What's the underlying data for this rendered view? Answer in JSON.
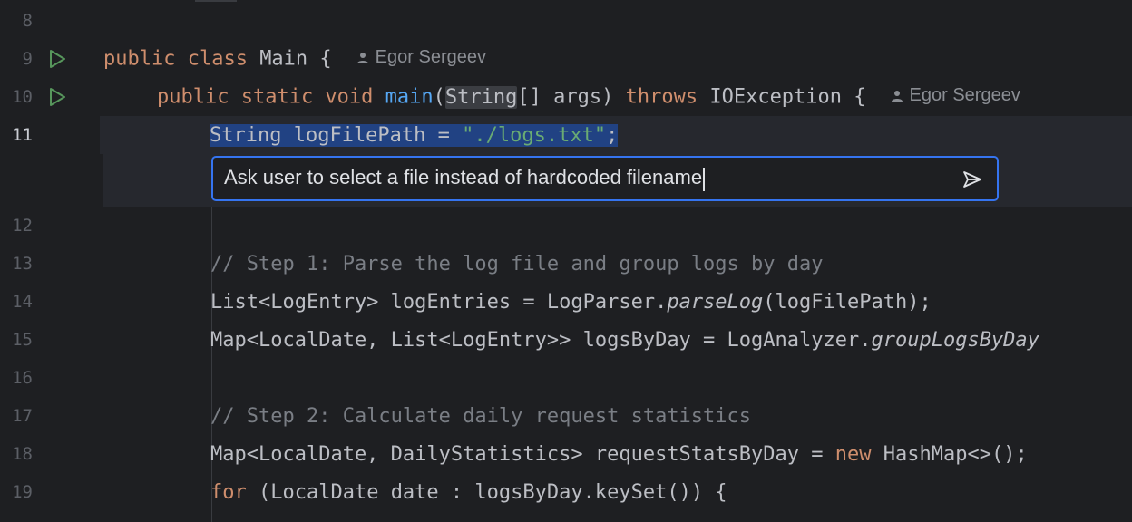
{
  "editor": {
    "lines": [
      {
        "num": "8",
        "code": ""
      },
      {
        "num": "9",
        "code_parts": {
          "kw1": "public class ",
          "name": "Main {"
        },
        "author": "Egor Sergeev"
      },
      {
        "num": "10",
        "code_parts": {
          "kw1": "public static void ",
          "fn": "main",
          "rest1": "(",
          "type": "String",
          "rest2": "[] args) ",
          "kw2": "throws",
          "rest3": " IOException {"
        },
        "author": "Egor Sergeev"
      },
      {
        "num": "11",
        "code_parts": {
          "t": "String logFilePath = ",
          "s": "\"./logs.txt\"",
          "e": ";"
        }
      },
      {
        "num": "12",
        "code": ""
      },
      {
        "num": "13",
        "code": "// Step 1: Parse the log file and group logs by day"
      },
      {
        "num": "14",
        "code_parts": {
          "a": "List<LogEntry> logEntries = LogParser.",
          "m": "parseLog",
          "b": "(logFilePath);"
        }
      },
      {
        "num": "15",
        "code_parts": {
          "a": "Map<LocalDate, List<LogEntry>> logsByDay = LogAnalyzer.",
          "m": "groupLogsByDay"
        }
      },
      {
        "num": "16",
        "code": ""
      },
      {
        "num": "17",
        "code": "// Step 2: Calculate daily request statistics"
      },
      {
        "num": "18",
        "code_parts": {
          "a": "Map<LocalDate, DailyStatistics> requestStatsByDay = ",
          "kw": "new",
          "b": " HashMap<>();"
        }
      },
      {
        "num": "19",
        "code_parts": {
          "kw": "for",
          "a": " (LocalDate date : logsByDay.keySet()) {"
        }
      }
    ]
  },
  "prompt": {
    "value": "Ask user to select a file instead of hardcoded filename"
  },
  "icons": {
    "run": "run-play-icon",
    "person": "person-icon",
    "send": "send-icon"
  },
  "colors": {
    "accent": "#3574f0",
    "selection": "#214283",
    "run_green": "#57965c"
  }
}
